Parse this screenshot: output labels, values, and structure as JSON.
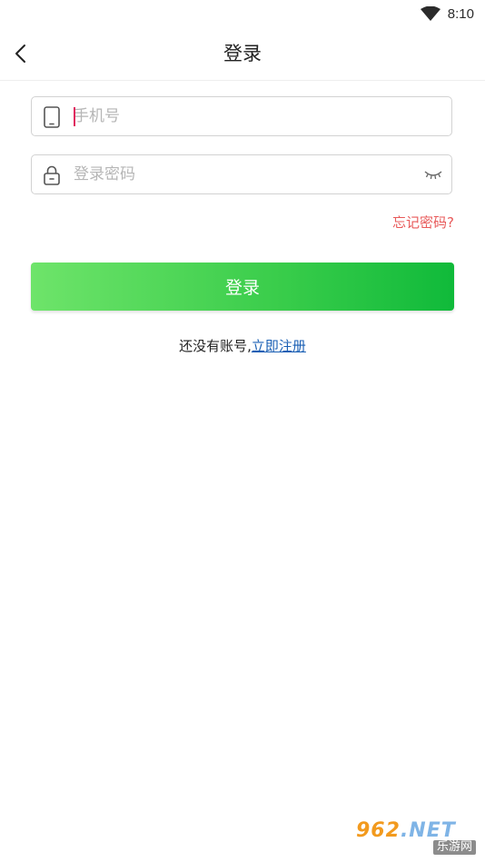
{
  "status_bar": {
    "time": "8:10",
    "wifi_icon": "wifi-icon"
  },
  "app_bar": {
    "back_icon": "chevron-left-icon",
    "title": "登录"
  },
  "form": {
    "phone": {
      "icon": "phone-icon",
      "placeholder": "手机号",
      "value": ""
    },
    "password": {
      "icon": "lock-icon",
      "placeholder": "登录密码",
      "value": "",
      "toggle_icon": "eye-closed-icon"
    },
    "forgot_label": "忘记密码?",
    "login_label": "登录",
    "register_prompt": "还没有账号,",
    "register_link": "立即注册"
  },
  "colors": {
    "accent_green": "#2fc749",
    "forgot_red": "#e85a5a",
    "link_blue": "#1a5fb4"
  },
  "watermark": {
    "brand_number": "962",
    "brand_suffix": ".NET",
    "brand_sub": "乐游网"
  }
}
